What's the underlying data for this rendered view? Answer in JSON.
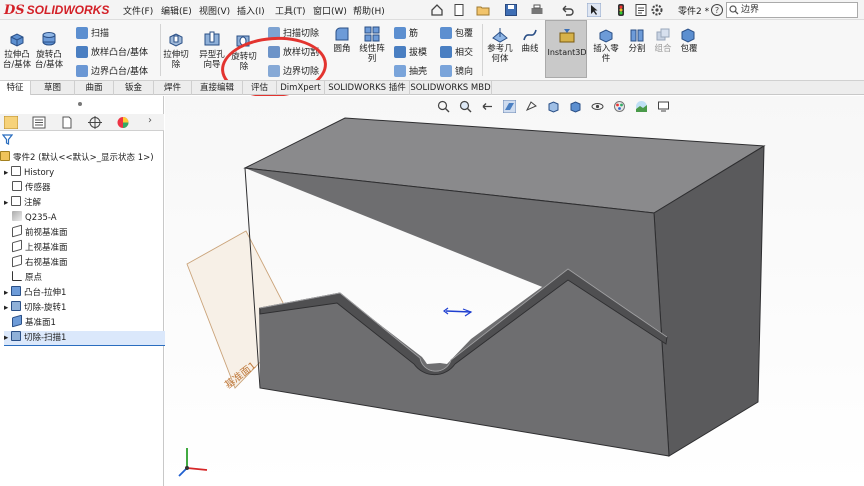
{
  "app": {
    "logo_ds": "DS",
    "logo_name": "SOLIDWORKS"
  },
  "menu": [
    "文件(F)",
    "编辑(E)",
    "视图(V)",
    "插入(I)",
    "工具(T)",
    "窗口(W)",
    "帮助(H)"
  ],
  "document_name": "零件2 *",
  "search": {
    "value": "边界"
  },
  "ribbon": {
    "extrude_boss": "拉伸凸\n台/基体",
    "revolve_boss": "旋转凸\n台/基体",
    "sweep": "扫描",
    "loft_boss": "放样凸台/基体",
    "boundary_boss": "边界凸台/基体",
    "extrude_cut": "拉伸切\n除",
    "hole_wizard": "异型孔\n向导",
    "revolve_cut": "旋转切\n除",
    "sweep_cut": "扫描切除",
    "loft_cut": "放样切割",
    "boundary_cut": "边界切除",
    "fillet": "圆角",
    "linear_pattern": "线性阵\n列",
    "rib": "筋",
    "draft": "拔模",
    "shell": "抽壳",
    "wrap": "包覆",
    "intersect": "相交",
    "mirror": "镜向",
    "ref_geometry": "参考几\n何体",
    "curves": "曲线",
    "instant3d": "Instant3D",
    "insert_part": "插入零\n件",
    "split": "分割",
    "combine": "组合",
    "wrap2": "包覆"
  },
  "tabs": [
    "特征",
    "草图",
    "曲面",
    "钣金",
    "焊件",
    "直接编辑",
    "评估",
    "DimXpert",
    "SOLIDWORKS 插件",
    "SOLIDWORKS MBD"
  ],
  "tree": {
    "root": "零件2 (默认<<默认>_显示状态 1>)",
    "items": [
      "History",
      "传感器",
      "注解",
      "Q235-A",
      "前视基准面",
      "上视基准面",
      "右视基准面",
      "原点",
      "凸台-拉伸1",
      "切除-旋转1",
      "基准面1",
      "切除-扫描1"
    ]
  },
  "viewport": {
    "plane_label": "基准面1"
  },
  "colors": {
    "accent": "#d32027",
    "annotation": "#e3342f",
    "model": "#6e6e70",
    "model_top": "#8a8a8c",
    "model_side": "#5a5a5c"
  }
}
